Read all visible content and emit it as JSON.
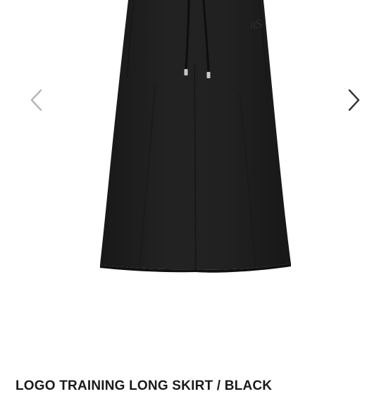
{
  "gallery": {
    "image_logo_text": "aS",
    "prev_icon": "chevron-left-icon",
    "next_icon": "chevron-right-icon",
    "prev_color": "#b5b5b5",
    "next_color": "#333333",
    "skirt_color": "#1f1f1f"
  },
  "product": {
    "title": "LOGO TRAINING LONG SKIRT / BLACK"
  }
}
